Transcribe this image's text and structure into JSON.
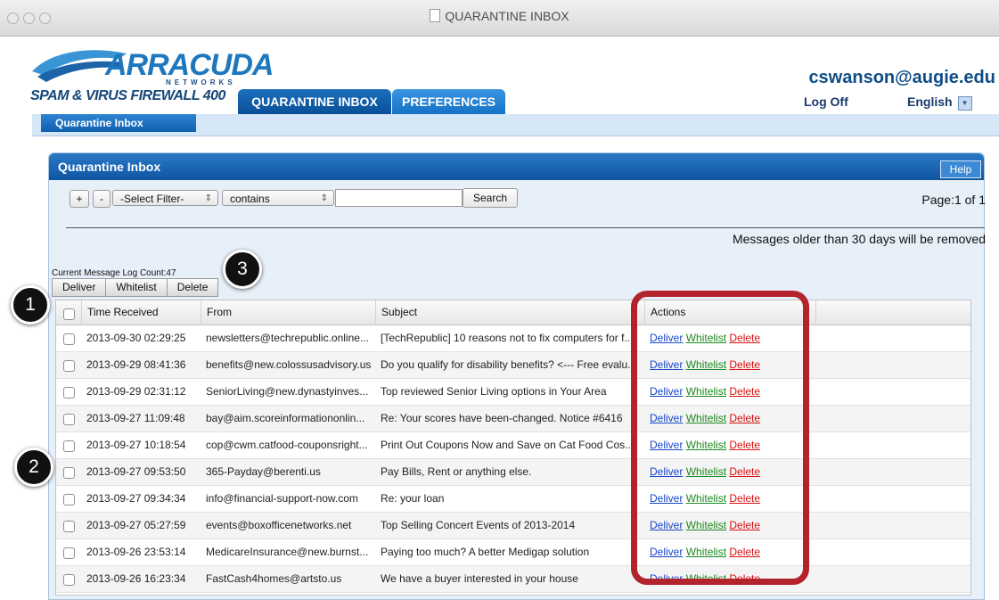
{
  "window": {
    "title": "QUARANTINE INBOX"
  },
  "header": {
    "logo_name": "ARRACUDA",
    "logo_sub": "NETWORKS",
    "product": "SPAM & VIRUS FIREWALL 400",
    "user": "cswanson@augie.edu",
    "logoff": "Log Off",
    "language": "English"
  },
  "tabs": {
    "quarantine": "QUARANTINE INBOX",
    "preferences": "PREFERENCES"
  },
  "subtab": "Quarantine Inbox",
  "panel": {
    "title": "Quarantine Inbox",
    "help": "Help",
    "filter": {
      "plus": "+",
      "minus": "-",
      "select_filter": "-Select Filter-",
      "operator": "contains",
      "search_value": "",
      "search_button": "Search"
    },
    "page_info": "Page:1 of 1",
    "retention_notice": "Messages older than 30 days will be removed",
    "log_count": "Current Message Log Count:47",
    "actions": {
      "deliver": "Deliver",
      "whitelist": "Whitelist",
      "delete": "Delete"
    },
    "columns": {
      "time": "Time Received",
      "from": "From",
      "subject": "Subject",
      "actions": "Actions"
    }
  },
  "rows": [
    {
      "time": "2013-09-30 02:29:25",
      "from": "newsletters@techrepublic.online...",
      "subject": "[TechRepublic] 10 reasons not to fix computers for f..."
    },
    {
      "time": "2013-09-29 08:41:36",
      "from": "benefits@new.colossusadvisory.us",
      "subject": "Do you qualify for disability benefits? <--- Free evalu..."
    },
    {
      "time": "2013-09-29 02:31:12",
      "from": "SeniorLiving@new.dynastyinves...",
      "subject": "Top reviewed Senior Living options in Your Area"
    },
    {
      "time": "2013-09-27 11:09:48",
      "from": "bay@aim.scoreinformationonlin...",
      "subject": "Re: Your scores have been-changed. Notice #6416"
    },
    {
      "time": "2013-09-27 10:18:54",
      "from": "cop@cwm.catfood-couponsright...",
      "subject": "Print Out Coupons Now and Save on Cat Food Cos..."
    },
    {
      "time": "2013-09-27 09:53:50",
      "from": "365-Payday@berenti.us",
      "subject": "Pay Bills, Rent or anything else."
    },
    {
      "time": "2013-09-27 09:34:34",
      "from": "info@financial-support-now.com",
      "subject": "Re: your loan"
    },
    {
      "time": "2013-09-27 05:27:59",
      "from": "events@boxofficenetworks.net",
      "subject": "Top Selling Concert Events of 2013-2014"
    },
    {
      "time": "2013-09-26 23:53:14",
      "from": "MedicareInsurance@new.burnst...",
      "subject": "Paying too much? A better Medigap solution"
    },
    {
      "time": "2013-09-26 16:23:34",
      "from": "FastCash4homes@artsto.us",
      "subject": "We have a buyer interested in your house"
    }
  ],
  "row_actions": {
    "deliver": "Deliver",
    "whitelist": "Whitelist",
    "delete": "Delete"
  },
  "callouts": [
    "1",
    "2",
    "3"
  ],
  "colors": {
    "accent": "#0f55a2",
    "highlight": "#b3232c",
    "deliver_link": "#1846c9",
    "whitelist_link": "#1c8a1f",
    "delete_link": "#d71111"
  }
}
